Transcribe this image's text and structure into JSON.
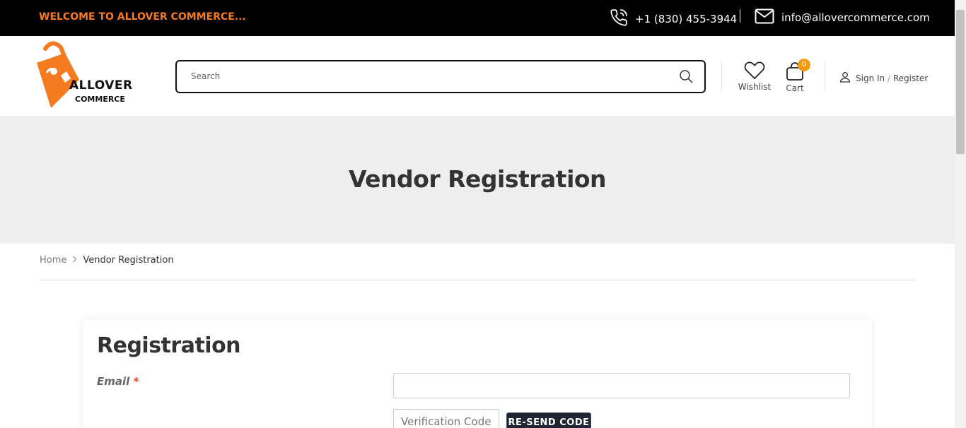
{
  "topbar": {
    "welcome": "WELCOME TO ALLOVER COMMERCE...",
    "phone": "+1 (830) 455-3944",
    "email": "info@allovercommerce.com",
    "icons": [
      "phone-icon",
      "envelope-icon"
    ]
  },
  "header": {
    "logo_line1": "ALLOVER",
    "logo_line2": "COMMERCE",
    "search_placeholder": "Search",
    "wishlist_label": "Wishlist",
    "cart_label": "Cart",
    "cart_count": "0",
    "sign_in": "Sign In",
    "separator": "/",
    "register": "Register"
  },
  "hero": {
    "title": "Vendor Registration"
  },
  "breadcrumb": {
    "home": "Home",
    "current": "Vendor Registration"
  },
  "form": {
    "title": "Registration",
    "email_label": "Email",
    "required_mark": "*",
    "email_value": "",
    "verification_placeholder": "Verification Code",
    "resend_label": "RE-SEND CODE"
  },
  "colors": {
    "accent": "#f47b20",
    "topbar_bg": "#000000",
    "hero_bg": "#eeeeee",
    "badge": "#f39c12",
    "button_bg": "#1e2533"
  }
}
